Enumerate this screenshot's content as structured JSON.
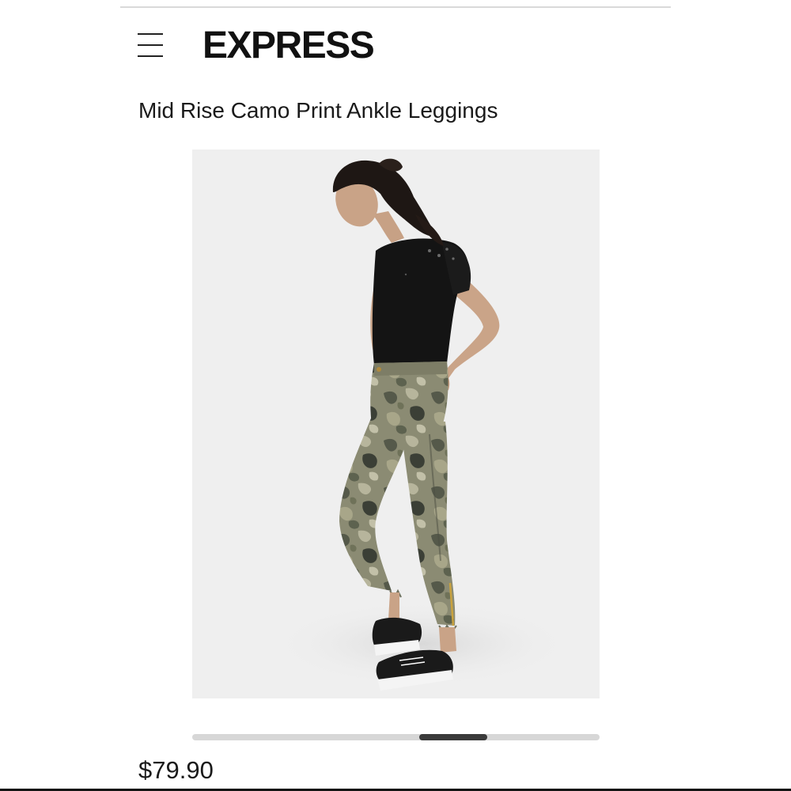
{
  "header": {
    "brand": "EXPRESS"
  },
  "product": {
    "title": "Mid Rise Camo Print Ankle Leggings",
    "price": "$79.90",
    "image_alt": "Model wearing black distressed tee, camo print ankle leggings with side zip, black sneakers"
  },
  "carousel": {
    "position_fraction": 0.67
  },
  "colors": {
    "image_background": "#efefef",
    "scroll_track": "#d7d7d7",
    "scroll_thumb": "#3b3b3b",
    "text": "#1a1a1a"
  }
}
